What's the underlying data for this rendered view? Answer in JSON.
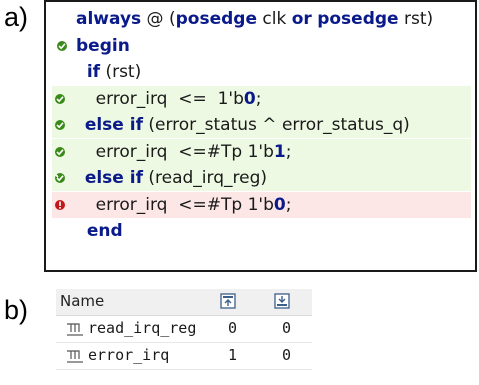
{
  "labels": {
    "a": "a)",
    "b": "b)"
  },
  "code": {
    "lines": [
      {
        "marker": "none",
        "segments": [
          [
            "kw",
            "always"
          ],
          [
            "plain",
            " @ ("
          ],
          [
            "kw",
            "posedge"
          ],
          [
            "plain",
            " clk "
          ],
          [
            "kw",
            "or"
          ],
          [
            "plain",
            " "
          ],
          [
            "kw",
            "posedge"
          ],
          [
            "plain",
            " rst)"
          ]
        ]
      },
      {
        "marker": "green",
        "segments": [
          [
            "kw",
            "begin"
          ]
        ]
      },
      {
        "marker": "none",
        "segments": [
          [
            "plain",
            "  "
          ],
          [
            "kw",
            "if"
          ],
          [
            "plain",
            " (rst)"
          ]
        ]
      },
      {
        "marker": "green",
        "segments": [
          [
            "plain",
            "    error_irq  <=  1'b"
          ],
          [
            "kw",
            "0"
          ],
          [
            "plain",
            ";"
          ]
        ]
      },
      {
        "marker": "green",
        "segments": [
          [
            "plain",
            "  "
          ],
          [
            "kw",
            "else if"
          ],
          [
            "plain",
            " (error_status ^ error_status_q)"
          ]
        ]
      },
      {
        "marker": "green",
        "segments": [
          [
            "plain",
            "    error_irq  <=#Tp 1'b"
          ],
          [
            "kw",
            "1"
          ],
          [
            "plain",
            ";"
          ]
        ]
      },
      {
        "marker": "partial",
        "segments": [
          [
            "plain",
            "  "
          ],
          [
            "kw",
            "else if"
          ],
          [
            "plain",
            " (read_irq_reg)"
          ]
        ]
      },
      {
        "marker": "red",
        "segments": [
          [
            "plain",
            "    error_irq  <=#Tp 1'b"
          ],
          [
            "kw",
            "0"
          ],
          [
            "plain",
            ";"
          ]
        ]
      },
      {
        "marker": "none",
        "segments": [
          [
            "plain",
            "  "
          ],
          [
            "kw",
            "end"
          ]
        ]
      }
    ],
    "colors": {
      "keyword": "#0a1a8a",
      "green_marker": "#3a8a1a",
      "red_marker": "#c01818",
      "green_bg": "#eef9e3",
      "red_bg": "#fde6e6"
    }
  },
  "wave": {
    "header": {
      "name": "Name",
      "icon1": "toggle-in-icon",
      "icon2": "toggle-out-icon"
    },
    "rows": [
      {
        "name": "read_irq_reg",
        "v1": "0",
        "v2": "0",
        "icon": "signal-wire-icon"
      },
      {
        "name": "error_irq",
        "v1": "1",
        "v2": "0",
        "icon": "signal-wire-icon"
      }
    ]
  }
}
